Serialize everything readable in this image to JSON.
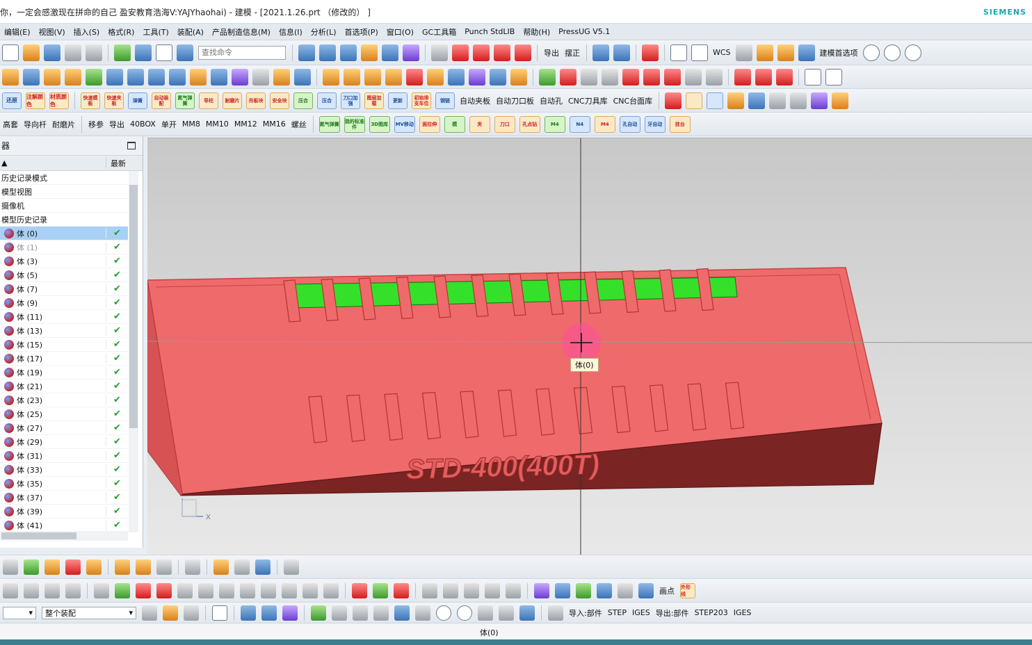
{
  "window": {
    "title": "你，一定会感激现在拼命的自己 盈安教育浩海V:YAJYhaohai) - 建模 - [2021.1.26.prt （修改的） ]",
    "brand": "SIEMENS"
  },
  "menu": [
    "编辑(E)",
    "视图(V)",
    "插入(S)",
    "格式(R)",
    "工具(T)",
    "装配(A)",
    "产品制造信息(M)",
    "信息(I)",
    "分析(L)",
    "首选项(P)",
    "窗口(O)",
    "GC工具箱",
    "Punch StdLIB",
    "帮助(H)",
    "PressUG V5.1"
  ],
  "toolbar1": {
    "search_placeholder": "查找命令",
    "export_label": "导出",
    "align_label": "摆正",
    "wcs_label": "WCS",
    "modeling_pref_label": "建模首选项"
  },
  "toolbar3": {
    "labels": [
      "快速模板",
      "快速夹板",
      "弹簧",
      "自动装配",
      "氮气弹簧",
      "导柱",
      "耐磨片",
      "吊板块",
      "安全块",
      "压合",
      "压合",
      "刀口加强",
      "图层加载",
      "更新",
      "初始排支车位",
      "钢链"
    ],
    "text_items": [
      "自动夹板",
      "自动刀口板",
      "自动孔",
      "CNC刀具库",
      "CNC台面库"
    ],
    "left_labels": [
      "还原",
      "注解颜色",
      "材质颜色"
    ]
  },
  "toolbar4": {
    "items": [
      "高套",
      "导向杆",
      "耐磨片",
      "移参",
      "导出",
      "40BOX",
      "单开",
      "MM8",
      "MM10",
      "MM12",
      "MM16",
      "螺丝"
    ],
    "icons_text": [
      "氮气弹簧",
      "我的标准件",
      "3D图库",
      "MV移动",
      "面拉伸",
      "模",
      "夹",
      "刀口",
      "孔点钻",
      "M4",
      "N4",
      "M4",
      "孔自动",
      "牙自动",
      "挂台"
    ]
  },
  "navigator": {
    "title": "器",
    "column_latest": "最新",
    "nodes": [
      {
        "label": "历史记录模式",
        "check": false,
        "icon": false,
        "dim": false,
        "selected": false
      },
      {
        "label": "模型视图",
        "check": false,
        "icon": false,
        "dim": false,
        "selected": false
      },
      {
        "label": "摄像机",
        "check": false,
        "icon": false,
        "dim": false,
        "selected": false
      },
      {
        "label": "模型历史记录",
        "check": false,
        "icon": false,
        "dim": false,
        "selected": false
      },
      {
        "label": "体 (0)",
        "check": true,
        "icon": true,
        "dim": false,
        "selected": true
      },
      {
        "label": "体 (1)",
        "check": true,
        "icon": true,
        "dim": true,
        "selected": false
      },
      {
        "label": "体 (3)",
        "check": true,
        "icon": true,
        "dim": false,
        "selected": false
      },
      {
        "label": "体 (5)",
        "check": true,
        "icon": true,
        "dim": false,
        "selected": false
      },
      {
        "label": "体 (7)",
        "check": true,
        "icon": true,
        "dim": false,
        "selected": false
      },
      {
        "label": "体 (9)",
        "check": true,
        "icon": true,
        "dim": false,
        "selected": false
      },
      {
        "label": "体 (11)",
        "check": true,
        "icon": true,
        "dim": false,
        "selected": false
      },
      {
        "label": "体 (13)",
        "check": true,
        "icon": true,
        "dim": false,
        "selected": false
      },
      {
        "label": "体 (15)",
        "check": true,
        "icon": true,
        "dim": false,
        "selected": false
      },
      {
        "label": "体 (17)",
        "check": true,
        "icon": true,
        "dim": false,
        "selected": false
      },
      {
        "label": "体 (19)",
        "check": true,
        "icon": true,
        "dim": false,
        "selected": false
      },
      {
        "label": "体 (21)",
        "check": true,
        "icon": true,
        "dim": false,
        "selected": false
      },
      {
        "label": "体 (23)",
        "check": true,
        "icon": true,
        "dim": false,
        "selected": false
      },
      {
        "label": "体 (25)",
        "check": true,
        "icon": true,
        "dim": false,
        "selected": false
      },
      {
        "label": "体 (27)",
        "check": true,
        "icon": true,
        "dim": false,
        "selected": false
      },
      {
        "label": "体 (29)",
        "check": true,
        "icon": true,
        "dim": false,
        "selected": false
      },
      {
        "label": "体 (31)",
        "check": true,
        "icon": true,
        "dim": false,
        "selected": false
      },
      {
        "label": "体 (33)",
        "check": true,
        "icon": true,
        "dim": false,
        "selected": false
      },
      {
        "label": "体 (35)",
        "check": true,
        "icon": true,
        "dim": false,
        "selected": false
      },
      {
        "label": "体 (37)",
        "check": true,
        "icon": true,
        "dim": false,
        "selected": false
      },
      {
        "label": "体 (39)",
        "check": true,
        "icon": true,
        "dim": false,
        "selected": false
      },
      {
        "label": "体 (41)",
        "check": true,
        "icon": true,
        "dim": false,
        "selected": false
      }
    ],
    "check_glyph": "✔"
  },
  "viewport": {
    "model_text": "STD-400(400T)",
    "tooltip": "体(0)",
    "axis_x": "X",
    "body_color": "#ef6a6a",
    "dark_face_color": "#7a2424",
    "insert_color": "#35e02a"
  },
  "bottom": {
    "draw_label": "画点",
    "shape_label": "外形线",
    "filter_left": "",
    "filter_assembly": "整个装配",
    "import_label": "导入:部件",
    "import_step": "STEP",
    "import_iges": "IGES",
    "export_label": "导出:部件",
    "export_step": "STEP203",
    "export_iges": "IGES"
  },
  "status": {
    "text": "体(0)"
  }
}
